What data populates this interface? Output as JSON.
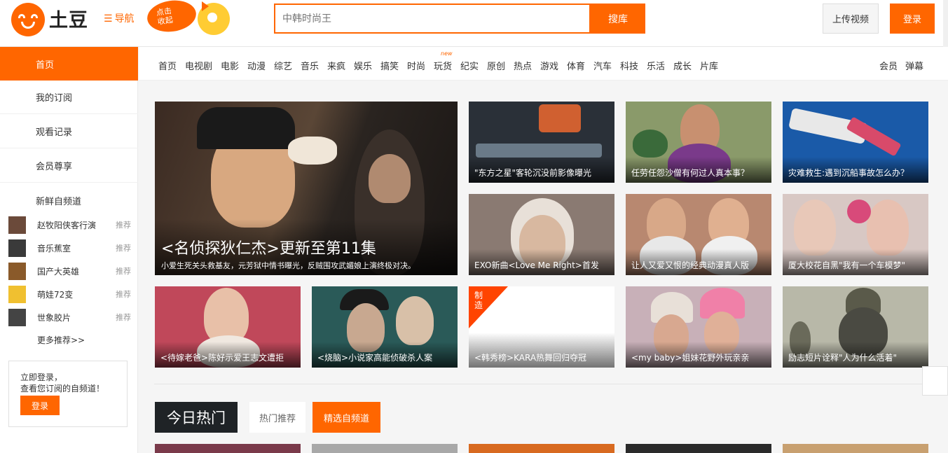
{
  "header": {
    "logo_text": "土豆",
    "nav_label": "导航",
    "promo_text_line1": "点击",
    "promo_text_line2": "收起",
    "search_placeholder": "中韩时尚王",
    "search_button": "搜库",
    "upload_button": "上传视频",
    "login_button": "登录"
  },
  "sidebar": {
    "items": [
      {
        "label": "首页",
        "active": true
      },
      {
        "label": "我的订阅"
      },
      {
        "label": "观看记录"
      },
      {
        "label": "会员尊享"
      }
    ],
    "section_title": "新鲜自频道",
    "channels": [
      {
        "name": "赵牧阳侠客行演",
        "tag": "推荐",
        "color": "#6b4a3a"
      },
      {
        "name": "音乐蕉室",
        "tag": "推荐",
        "color": "#3a3a3a"
      },
      {
        "name": "国产大英雄",
        "tag": "推荐",
        "color": "#8a5a2a"
      },
      {
        "name": "萌娃72变",
        "tag": "推荐",
        "color": "#f0c030"
      },
      {
        "name": "世象胶片",
        "tag": "推荐",
        "color": "#444444"
      }
    ],
    "more_label": "更多推荐>>",
    "login_card": {
      "line1": "立即登录，",
      "line2": "查看您订阅的自频道！",
      "button": "登录"
    }
  },
  "categories": [
    "首页",
    "电视剧",
    "电影",
    "动漫",
    "综艺",
    "音乐",
    "来疯",
    "娱乐",
    "搞笑",
    "时尚",
    "玩货",
    "纪实",
    "原创",
    "热点",
    "游戏",
    "体育",
    "汽车",
    "科技",
    "乐活",
    "成长",
    "片库"
  ],
  "new_tag": "new",
  "right_links": [
    "会员",
    "弹幕"
  ],
  "feature": {
    "title": "<名侦探狄仁杰>更新至第11集",
    "subtitle": "小爱生死关头救基友，元芳狱中情书曝光，反贼围攻武媚娘上演终极对决。"
  },
  "tiles": [
    {
      "caption": "\"东方之星\"客轮沉没前影像曝光",
      "bg": "#2a3038"
    },
    {
      "caption": "任劳任怨沙僧有何过人真本事？",
      "bg": "#8a9a6a"
    },
    {
      "caption": "灾难救生:遇到沉船事故怎么办？",
      "bg": "#1a5aa8"
    },
    {
      "caption": "EXO新曲<Love Me Right>首发",
      "bg": "#8a7a72"
    },
    {
      "caption": "让人又爱又恨的经典动漫真人版",
      "bg": "#b88870"
    },
    {
      "caption": "厦大校花自黑\"我有一个车模梦\"",
      "bg": "#d8c8c4"
    },
    {
      "caption": "<待嫁老爸>陈好示爱王志文遭拒",
      "bg": "#c0485a"
    },
    {
      "caption": "<烧脑>小说家高能侦破杀人案",
      "bg": "#2a5a58"
    },
    {
      "caption": "<韩秀榜>KARA热舞回归夺冠",
      "bg": "#ffffff"
    },
    {
      "caption": "<my baby>姐妹花野外玩亲亲",
      "bg": "#c8b0b8"
    },
    {
      "caption": "励志短片诠释\"人为什么活着\"",
      "bg": "#b8b8a8"
    }
  ],
  "make_badge": "制造",
  "hot": {
    "title": "今日热门",
    "tab1": "热门推荐",
    "tab2": "精选自频道"
  }
}
